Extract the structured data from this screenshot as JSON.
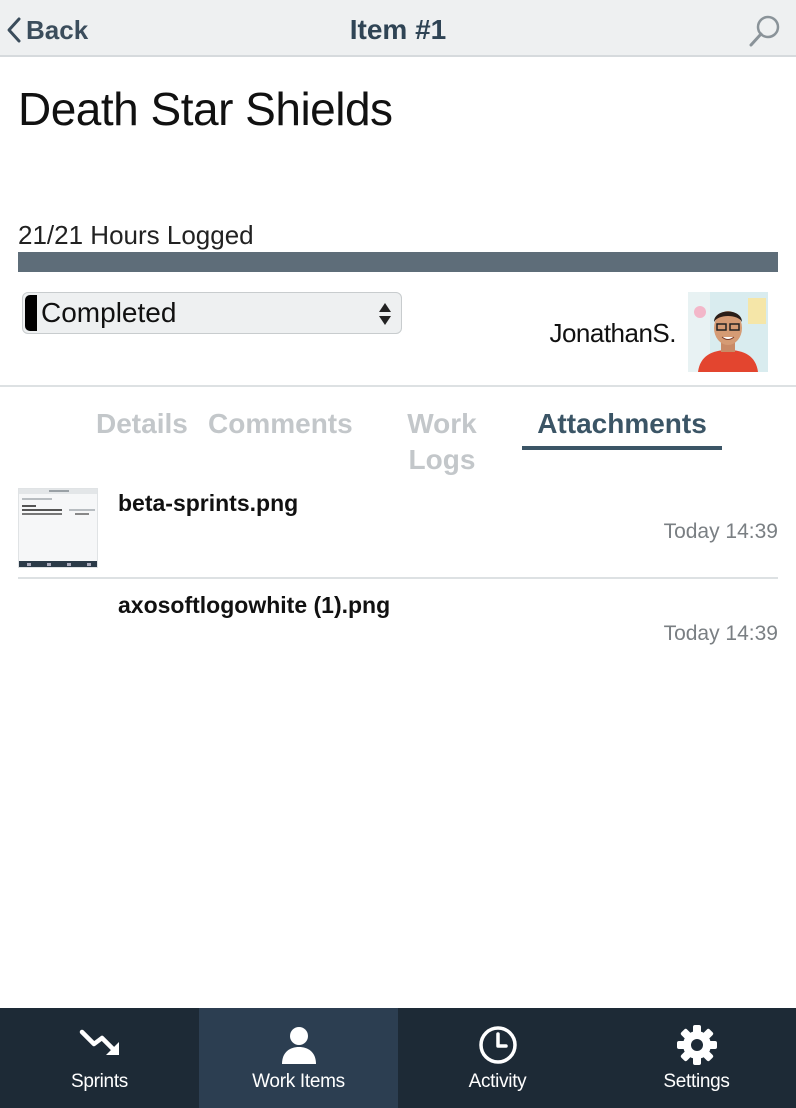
{
  "navbar": {
    "back_label": "Back",
    "title": "Item #1"
  },
  "item": {
    "title": "Death Star Shields",
    "hours_logged_text": "21/21 Hours Logged",
    "progress_fraction": 1.0,
    "status": "Completed",
    "assignee": "JonathanS."
  },
  "tabs": [
    {
      "label": "Details"
    },
    {
      "label": "Comments"
    },
    {
      "label": "Work Logs"
    },
    {
      "label": "Attachments"
    }
  ],
  "attachments": [
    {
      "name": "beta-sprints.png",
      "time": "Today 14:39"
    },
    {
      "name": "axosoftlogowhite (1).png",
      "time": "Today 14:39"
    }
  ],
  "tabbar": [
    {
      "label": "Sprints",
      "icon": "trend-down-icon"
    },
    {
      "label": "Work Items",
      "icon": "person-icon"
    },
    {
      "label": "Activity",
      "icon": "clock-icon"
    },
    {
      "label": "Settings",
      "icon": "gear-icon"
    }
  ],
  "colors": {
    "navbar_bg": "#eef0f1",
    "accent": "#3b5566",
    "progress_fill": "#5e6d79",
    "tabbar_bg": "#1d2a36",
    "tabbar_active_bg": "#2c3e51"
  }
}
